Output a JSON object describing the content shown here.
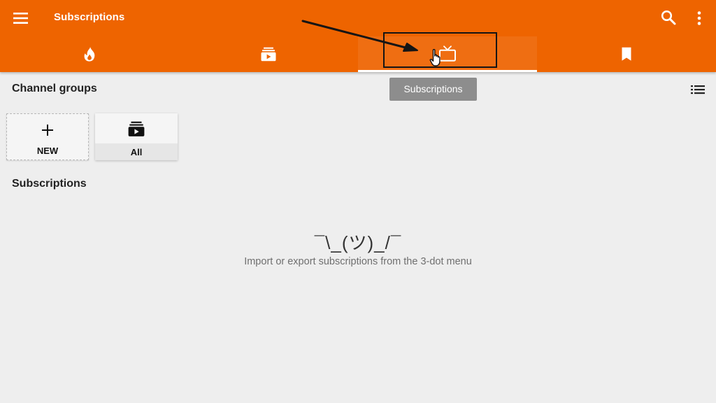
{
  "toolbar": {
    "title": "Subscriptions",
    "menu_icon": "menu-icon",
    "search_icon": "search-icon",
    "more_icon": "more-vertical-icon"
  },
  "tabs": [
    {
      "icon": "fire-icon",
      "active": false
    },
    {
      "icon": "feed-icon",
      "active": false
    },
    {
      "icon": "tv-icon",
      "active": true
    },
    {
      "icon": "bookmark-icon",
      "active": false
    }
  ],
  "tooltip": {
    "text": "Subscriptions"
  },
  "channel_groups": {
    "title": "Channel groups",
    "view_toggle_icon": "list-view-icon",
    "cards": [
      {
        "label": "NEW",
        "icon": "plus-icon"
      },
      {
        "label": "All",
        "icon": "feed-icon"
      }
    ]
  },
  "subscriptions": {
    "title": "Subscriptions",
    "empty_emoji": "¯\\_(ツ)_/¯",
    "empty_message": "Import or export subscriptions from the 3-dot menu"
  },
  "colors": {
    "accent": "#ee6400",
    "background": "#eeeeee",
    "tooltip": "#8d8d8d",
    "annotation": "#151515"
  }
}
